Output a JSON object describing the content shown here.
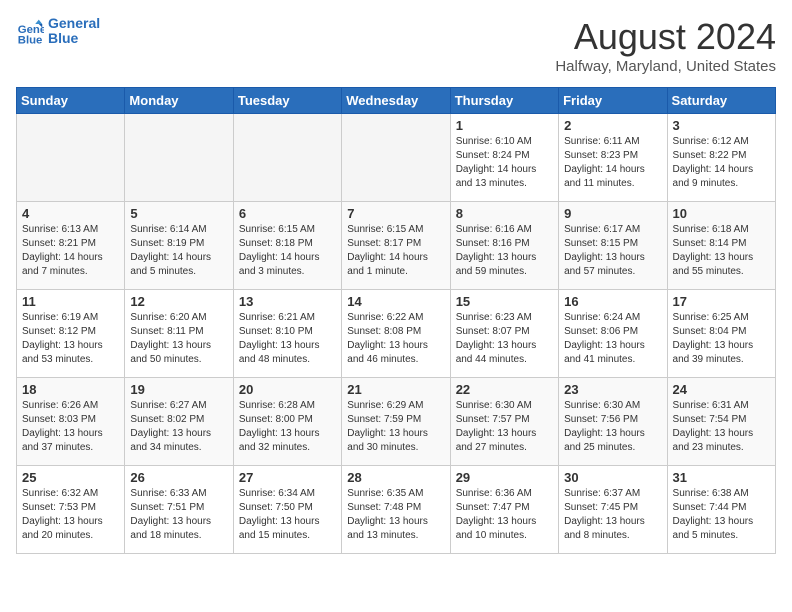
{
  "logo": {
    "line1": "General",
    "line2": "Blue"
  },
  "title": "August 2024",
  "subtitle": "Halfway, Maryland, United States",
  "days_of_week": [
    "Sunday",
    "Monday",
    "Tuesday",
    "Wednesday",
    "Thursday",
    "Friday",
    "Saturday"
  ],
  "weeks": [
    [
      {
        "day": "",
        "info": ""
      },
      {
        "day": "",
        "info": ""
      },
      {
        "day": "",
        "info": ""
      },
      {
        "day": "",
        "info": ""
      },
      {
        "day": "1",
        "info": "Sunrise: 6:10 AM\nSunset: 8:24 PM\nDaylight: 14 hours\nand 13 minutes."
      },
      {
        "day": "2",
        "info": "Sunrise: 6:11 AM\nSunset: 8:23 PM\nDaylight: 14 hours\nand 11 minutes."
      },
      {
        "day": "3",
        "info": "Sunrise: 6:12 AM\nSunset: 8:22 PM\nDaylight: 14 hours\nand 9 minutes."
      }
    ],
    [
      {
        "day": "4",
        "info": "Sunrise: 6:13 AM\nSunset: 8:21 PM\nDaylight: 14 hours\nand 7 minutes."
      },
      {
        "day": "5",
        "info": "Sunrise: 6:14 AM\nSunset: 8:19 PM\nDaylight: 14 hours\nand 5 minutes."
      },
      {
        "day": "6",
        "info": "Sunrise: 6:15 AM\nSunset: 8:18 PM\nDaylight: 14 hours\nand 3 minutes."
      },
      {
        "day": "7",
        "info": "Sunrise: 6:15 AM\nSunset: 8:17 PM\nDaylight: 14 hours\nand 1 minute."
      },
      {
        "day": "8",
        "info": "Sunrise: 6:16 AM\nSunset: 8:16 PM\nDaylight: 13 hours\nand 59 minutes."
      },
      {
        "day": "9",
        "info": "Sunrise: 6:17 AM\nSunset: 8:15 PM\nDaylight: 13 hours\nand 57 minutes."
      },
      {
        "day": "10",
        "info": "Sunrise: 6:18 AM\nSunset: 8:14 PM\nDaylight: 13 hours\nand 55 minutes."
      }
    ],
    [
      {
        "day": "11",
        "info": "Sunrise: 6:19 AM\nSunset: 8:12 PM\nDaylight: 13 hours\nand 53 minutes."
      },
      {
        "day": "12",
        "info": "Sunrise: 6:20 AM\nSunset: 8:11 PM\nDaylight: 13 hours\nand 50 minutes."
      },
      {
        "day": "13",
        "info": "Sunrise: 6:21 AM\nSunset: 8:10 PM\nDaylight: 13 hours\nand 48 minutes."
      },
      {
        "day": "14",
        "info": "Sunrise: 6:22 AM\nSunset: 8:08 PM\nDaylight: 13 hours\nand 46 minutes."
      },
      {
        "day": "15",
        "info": "Sunrise: 6:23 AM\nSunset: 8:07 PM\nDaylight: 13 hours\nand 44 minutes."
      },
      {
        "day": "16",
        "info": "Sunrise: 6:24 AM\nSunset: 8:06 PM\nDaylight: 13 hours\nand 41 minutes."
      },
      {
        "day": "17",
        "info": "Sunrise: 6:25 AM\nSunset: 8:04 PM\nDaylight: 13 hours\nand 39 minutes."
      }
    ],
    [
      {
        "day": "18",
        "info": "Sunrise: 6:26 AM\nSunset: 8:03 PM\nDaylight: 13 hours\nand 37 minutes."
      },
      {
        "day": "19",
        "info": "Sunrise: 6:27 AM\nSunset: 8:02 PM\nDaylight: 13 hours\nand 34 minutes."
      },
      {
        "day": "20",
        "info": "Sunrise: 6:28 AM\nSunset: 8:00 PM\nDaylight: 13 hours\nand 32 minutes."
      },
      {
        "day": "21",
        "info": "Sunrise: 6:29 AM\nSunset: 7:59 PM\nDaylight: 13 hours\nand 30 minutes."
      },
      {
        "day": "22",
        "info": "Sunrise: 6:30 AM\nSunset: 7:57 PM\nDaylight: 13 hours\nand 27 minutes."
      },
      {
        "day": "23",
        "info": "Sunrise: 6:30 AM\nSunset: 7:56 PM\nDaylight: 13 hours\nand 25 minutes."
      },
      {
        "day": "24",
        "info": "Sunrise: 6:31 AM\nSunset: 7:54 PM\nDaylight: 13 hours\nand 23 minutes."
      }
    ],
    [
      {
        "day": "25",
        "info": "Sunrise: 6:32 AM\nSunset: 7:53 PM\nDaylight: 13 hours\nand 20 minutes."
      },
      {
        "day": "26",
        "info": "Sunrise: 6:33 AM\nSunset: 7:51 PM\nDaylight: 13 hours\nand 18 minutes."
      },
      {
        "day": "27",
        "info": "Sunrise: 6:34 AM\nSunset: 7:50 PM\nDaylight: 13 hours\nand 15 minutes."
      },
      {
        "day": "28",
        "info": "Sunrise: 6:35 AM\nSunset: 7:48 PM\nDaylight: 13 hours\nand 13 minutes."
      },
      {
        "day": "29",
        "info": "Sunrise: 6:36 AM\nSunset: 7:47 PM\nDaylight: 13 hours\nand 10 minutes."
      },
      {
        "day": "30",
        "info": "Sunrise: 6:37 AM\nSunset: 7:45 PM\nDaylight: 13 hours\nand 8 minutes."
      },
      {
        "day": "31",
        "info": "Sunrise: 6:38 AM\nSunset: 7:44 PM\nDaylight: 13 hours\nand 5 minutes."
      }
    ]
  ]
}
